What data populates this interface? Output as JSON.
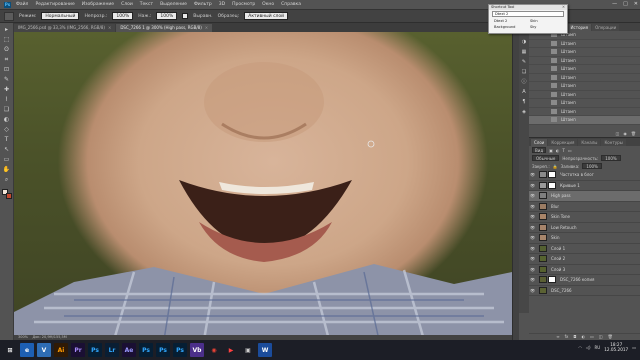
{
  "menu": {
    "logo": "Ps",
    "items": [
      "Файл",
      "Редактирование",
      "Изображение",
      "Слои",
      "Текст",
      "Выделение",
      "Фильтр",
      "3D",
      "Просмотр",
      "Окно",
      "Справка"
    ],
    "window_controls": [
      "—",
      "□",
      "✕"
    ]
  },
  "options": {
    "mode_label": "Режим:",
    "mode_value": "Нормальный",
    "opacity_label": "Непрозр.:",
    "opacity_value": "100%",
    "flow_label": "Наж.:",
    "flow_value": "100%",
    "align_label": "Выравн.",
    "sample_label": "Образец:",
    "sample_value": "Активный слой"
  },
  "tabs": [
    {
      "label": "IMG_2566.psd @ 33,3% (IMG_2566, RGB/8)",
      "active": false
    },
    {
      "label": "DSC_7266 1 @ 300% (High pass, RGB/8)",
      "active": true
    }
  ],
  "tools": [
    "▸",
    "⬚",
    "ʘ",
    "⌗",
    "⊡",
    "✎",
    "✚",
    "⌇",
    "❏",
    "◐",
    "◇",
    "T",
    "↖",
    "▭",
    "✋",
    "⌕"
  ],
  "status": {
    "zoom": "300%",
    "doc": "Док: 20,9M/155,5M"
  },
  "popup": {
    "title": "Shortcut Tool",
    "close": "✕",
    "selected": "Dtext 2",
    "rows": [
      {
        "a": "Dtext 2",
        "b": "Skin"
      },
      {
        "a": "Background",
        "b": "Sky"
      }
    ]
  },
  "right_panel": {
    "top_tabs": [
      {
        "label": "Свойства",
        "active": false
      },
      {
        "label": "История",
        "active": true
      },
      {
        "label": "Операции",
        "active": false
      }
    ],
    "history_items": [
      "Штамп",
      "Штамп",
      "Штамп",
      "Штамп",
      "Штамп",
      "Штамп",
      "Штамп",
      "Штамп",
      "Штамп",
      "Штамп",
      "Штамп"
    ],
    "history_selected": 10,
    "layer_tabs": [
      {
        "label": "Слои",
        "active": true
      },
      {
        "label": "Коррекция",
        "active": false
      },
      {
        "label": "Каналы",
        "active": false
      },
      {
        "label": "Контуры",
        "active": false
      }
    ],
    "filter_label": "Вид",
    "blend_mode": "Обычные",
    "opacity_label": "Непрозрачность:",
    "opacity_value": "100%",
    "lock_label": "Закреп.:",
    "fill_label": "Заливка:",
    "fill_value": "100%",
    "layers": [
      {
        "name": "Частотка в блог",
        "thumb": "#8a8a8a",
        "mask": true,
        "eye": true,
        "sel": false
      },
      {
        "name": "Кривые 1",
        "thumb": "#9a9a9a",
        "mask": true,
        "eye": true,
        "sel": false
      },
      {
        "name": "High pass",
        "thumb": "#7f7f7f",
        "mask": false,
        "eye": true,
        "sel": true
      },
      {
        "name": "Blur",
        "thumb": "#9b7c63",
        "mask": false,
        "eye": true,
        "sel": false
      },
      {
        "name": "Skin Tone",
        "thumb": "#a88468",
        "mask": false,
        "eye": true,
        "sel": false
      },
      {
        "name": "Low Retouch",
        "thumb": "#a5836a",
        "mask": false,
        "eye": true,
        "sel": false
      },
      {
        "name": "Skin",
        "thumb": "#a6856b",
        "mask": false,
        "eye": true,
        "sel": false
      },
      {
        "name": "Слой 1",
        "thumb": "#546032",
        "mask": false,
        "eye": true,
        "sel": false
      },
      {
        "name": "Слой 2",
        "thumb": "#566330",
        "mask": false,
        "eye": true,
        "sel": false
      },
      {
        "name": "Слой 3",
        "thumb": "#56612f",
        "mask": false,
        "eye": true,
        "sel": false
      },
      {
        "name": "DSC_7266 копия",
        "thumb": "#5a5f34",
        "mask": true,
        "eye": true,
        "sel": false
      },
      {
        "name": "DSC_7266",
        "thumb": "#5b6233",
        "mask": false,
        "eye": true,
        "sel": false
      }
    ]
  },
  "taskbar": {
    "apps": [
      {
        "label": "⊞",
        "bg": "#1c1e26",
        "color": "#ffffff"
      },
      {
        "label": "e",
        "bg": "#1d5fb3",
        "color": "#ffffff"
      },
      {
        "label": "V",
        "bg": "#2e6db5",
        "color": "#ffffff"
      },
      {
        "label": "Ai",
        "bg": "#2f1a06",
        "color": "#ff9a00"
      },
      {
        "label": "Pr",
        "bg": "#1a0f33",
        "color": "#a78bfa"
      },
      {
        "label": "Ps",
        "bg": "#061e33",
        "color": "#31a8ff"
      },
      {
        "label": "Lr",
        "bg": "#0a1e33",
        "color": "#31a8ff"
      },
      {
        "label": "Ae",
        "bg": "#1a0f33",
        "color": "#9999ff"
      },
      {
        "label": "Ps",
        "bg": "#061e33",
        "color": "#31a8ff"
      },
      {
        "label": "Ps",
        "bg": "#061e33",
        "color": "#31a8ff"
      },
      {
        "label": "Ps",
        "bg": "#061e33",
        "color": "#31a8ff"
      },
      {
        "label": "Vb",
        "bg": "#4b2f8a",
        "color": "#ffffff"
      },
      {
        "label": "◉",
        "bg": "#1c1e26",
        "color": "#e94235"
      },
      {
        "label": "▶",
        "bg": "#1c1e26",
        "color": "#ff4040"
      },
      {
        "label": "▣",
        "bg": "#1c1e26",
        "color": "#cfcfcf"
      },
      {
        "label": "W",
        "bg": "#1b4c9b",
        "color": "#ffffff"
      }
    ],
    "lang": "RU",
    "time": "18:27",
    "date": "12.05.2017"
  }
}
